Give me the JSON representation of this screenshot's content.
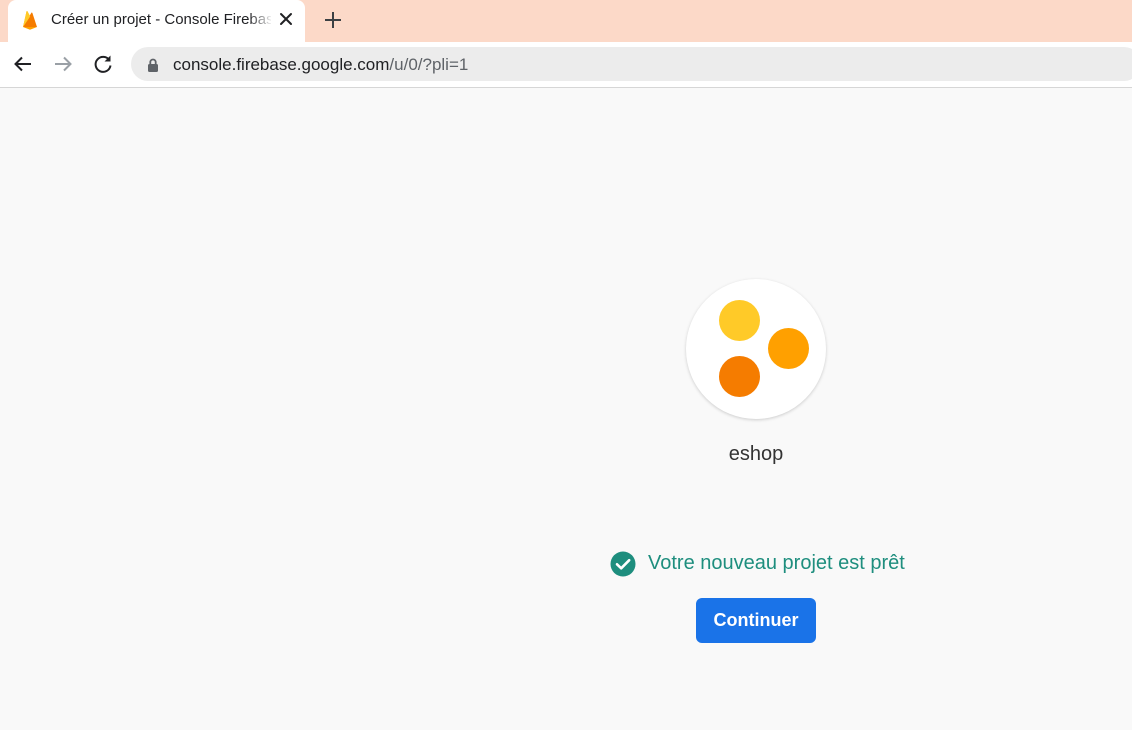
{
  "browser": {
    "tab": {
      "title": "Créer un projet - Console Firebase",
      "favicon": "firebase-icon"
    },
    "new_tab_icon": "plus-icon",
    "close_icon": "close-icon",
    "nav": {
      "back_icon": "back-arrow-icon",
      "forward_icon": "forward-arrow-icon",
      "reload_icon": "reload-icon"
    },
    "address": {
      "lock_icon": "lock-icon",
      "host": "console.firebase.google.com",
      "path": "/u/0/?pli=1"
    },
    "colors": {
      "tabstrip": "#fcd9c8",
      "omnibox": "#ececec"
    }
  },
  "project": {
    "name": "eshop",
    "logo_colors": [
      "#ffca28",
      "#ffa000",
      "#f57c00"
    ]
  },
  "status": {
    "icon": "check-circle-icon",
    "text": "Votre nouveau projet est prêt",
    "color": "#1e8e7e"
  },
  "continue_button": {
    "label": "Continuer",
    "color": "#1a73e8"
  }
}
